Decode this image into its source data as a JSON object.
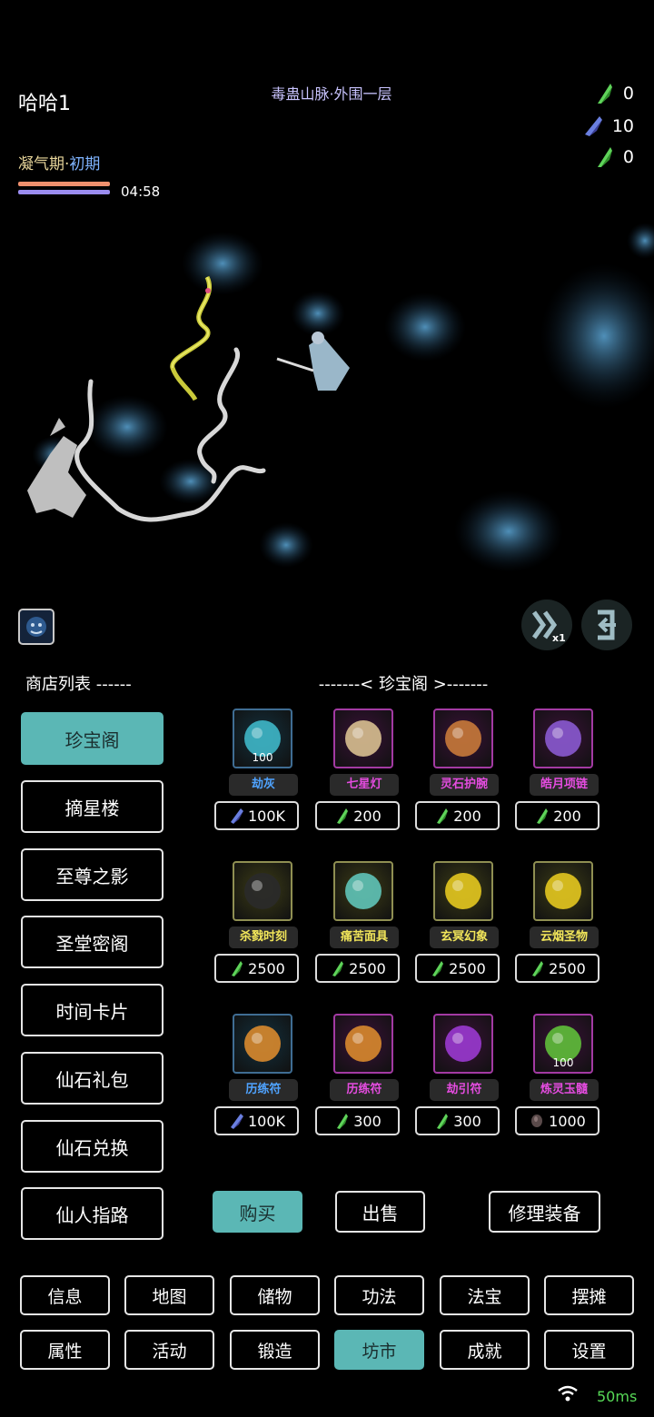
{
  "hud": {
    "player_name": "哈哈1",
    "map_name": "毒蛊山脉·外围一层",
    "realm_main": "凝气期·",
    "realm_sub": "初期",
    "timer": "04:58",
    "currencies": [
      {
        "icon": "green-crystal-icon",
        "value": "0",
        "color": "#5fd35a"
      },
      {
        "icon": "blue-crystal-icon",
        "value": "10",
        "color": "#6a7fe0"
      },
      {
        "icon": "green-crystal-icon",
        "value": "0",
        "color": "#5fd35a"
      }
    ]
  },
  "shop": {
    "list_title": "商店列表 ------",
    "title": "-------< 珍宝阁 >-------",
    "list": [
      "珍宝阁",
      "摘星楼",
      "至尊之影",
      "圣堂密阁",
      "时间卡片",
      "仙石礼包",
      "仙石兑换",
      "仙人指路"
    ],
    "active_index": 0,
    "items": [
      {
        "name": "劫灰",
        "qty": "100",
        "price": "100K",
        "currency": "blue-crystal-icon",
        "name_color": "#4fa3ff",
        "frame": "#3f6d93",
        "bg": "#12303d",
        "art": "#3fb7c8"
      },
      {
        "name": "七星灯",
        "qty": "",
        "price": "200",
        "currency": "green-crystal-icon",
        "name_color": "#e54ce0",
        "frame": "#a33aa3",
        "bg": "#3a1138",
        "art": "#d8c090"
      },
      {
        "name": "灵石护腕",
        "qty": "",
        "price": "200",
        "currency": "green-crystal-icon",
        "name_color": "#e54ce0",
        "frame": "#a33aa3",
        "bg": "#3a1138",
        "art": "#c87a3a"
      },
      {
        "name": "皓月项链",
        "qty": "",
        "price": "200",
        "currency": "green-crystal-icon",
        "name_color": "#e54ce0",
        "frame": "#a33aa3",
        "bg": "#3a1138",
        "art": "#8a5ad0"
      },
      {
        "name": "杀戮时刻",
        "qty": "",
        "price": "2500",
        "currency": "green-crystal-icon",
        "name_color": "#f2e65a",
        "frame": "#8f8f52",
        "bg": "#3d3d16",
        "art": "#2a2a2a"
      },
      {
        "name": "痛苦面具",
        "qty": "",
        "price": "2500",
        "currency": "green-crystal-icon",
        "name_color": "#f2e65a",
        "frame": "#8f8f52",
        "bg": "#3d3d16",
        "art": "#5fc4b8"
      },
      {
        "name": "玄冥幻象",
        "qty": "",
        "price": "2500",
        "currency": "green-crystal-icon",
        "name_color": "#f2e65a",
        "frame": "#8f8f52",
        "bg": "#3d3d16",
        "art": "#e4c81f"
      },
      {
        "name": "云烟圣物",
        "qty": "",
        "price": "2500",
        "currency": "green-crystal-icon",
        "name_color": "#f2e65a",
        "frame": "#8f8f52",
        "bg": "#3d3d16",
        "art": "#e4c81f"
      },
      {
        "name": "历练符",
        "qty": "",
        "price": "100K",
        "currency": "blue-crystal-icon",
        "name_color": "#4fa3ff",
        "frame": "#3f6d93",
        "bg": "#12303d",
        "art": "#d98a2e"
      },
      {
        "name": "历练符",
        "qty": "",
        "price": "300",
        "currency": "green-crystal-icon",
        "name_color": "#e54ce0",
        "frame": "#a33aa3",
        "bg": "#3a1138",
        "art": "#d98a2e"
      },
      {
        "name": "劫引符",
        "qty": "",
        "price": "300",
        "currency": "green-crystal-icon",
        "name_color": "#e54ce0",
        "frame": "#a33aa3",
        "bg": "#3a1138",
        "art": "#9a3ad0"
      },
      {
        "name": "炼灵玉髓",
        "qty": "100",
        "price": "1000",
        "currency": "dark-stone-icon",
        "name_color": "#e54ce0",
        "frame": "#a33aa3",
        "bg": "#3a1138",
        "art": "#5fbf3a"
      }
    ]
  },
  "actions": {
    "buy": "购买",
    "sell": "出售",
    "repair": "修理装备"
  },
  "nav": {
    "row1": [
      "信息",
      "地图",
      "储物",
      "功法",
      "法宝",
      "摆摊"
    ],
    "row2": [
      "属性",
      "活动",
      "锻造",
      "坊市",
      "成就",
      "设置"
    ],
    "active": "坊市"
  },
  "status": {
    "ping": "50ms"
  }
}
